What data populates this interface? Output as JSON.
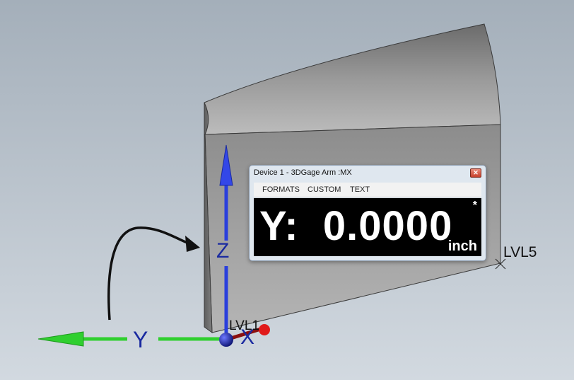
{
  "viewport": {
    "axis_labels": {
      "z": "Z",
      "y": "Y",
      "x": "X"
    },
    "point_labels": {
      "lvl1": "LVL1",
      "lvl5": "LVL5"
    },
    "colors": {
      "z_axis": "#2a3fdc",
      "y_axis": "#2fcf2f",
      "x_axis": "#c81e1e",
      "bg": "#a9b4bf"
    }
  },
  "device_window": {
    "title": "Device 1 - 3DGage Arm :MX",
    "menu": [
      "FORMATS",
      "CUSTOM",
      "TEXT"
    ],
    "readout": {
      "value": "Y:  0.0000",
      "unit": "inch",
      "flag": "*"
    }
  }
}
